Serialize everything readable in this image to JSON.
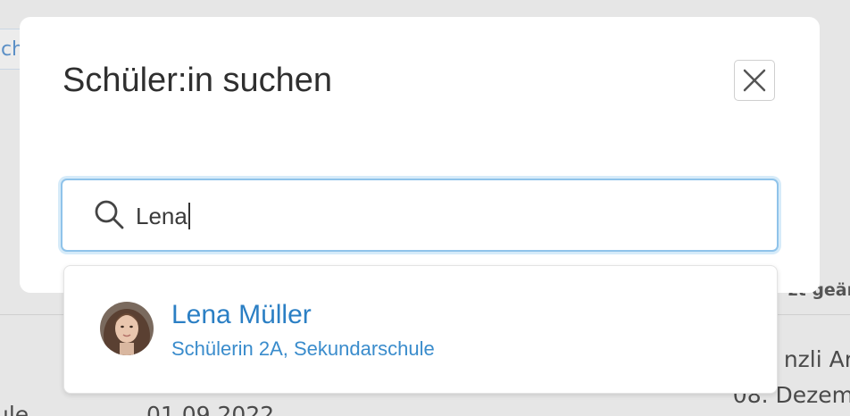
{
  "background": {
    "tab_fragment": "ch",
    "column_header_fragment": "zt geär",
    "cell_name_fragment": "nzli Ar",
    "cell_date_fragment": "08. Dezem",
    "left_fragment": "ule",
    "date_fragment": "01.09.2022"
  },
  "modal": {
    "title": "Schüler:in suchen",
    "close_icon": "close-icon"
  },
  "search": {
    "icon": "search-icon",
    "value": "Lena"
  },
  "results": [
    {
      "name": "Lena Müller",
      "subtitle": "Schülerin 2A, Sekundarschule",
      "avatar": "avatar-photo"
    }
  ],
  "colors": {
    "accent": "#2b7fc4",
    "focus_border": "#8fc3ea",
    "overlay": "#e6e6e6"
  }
}
